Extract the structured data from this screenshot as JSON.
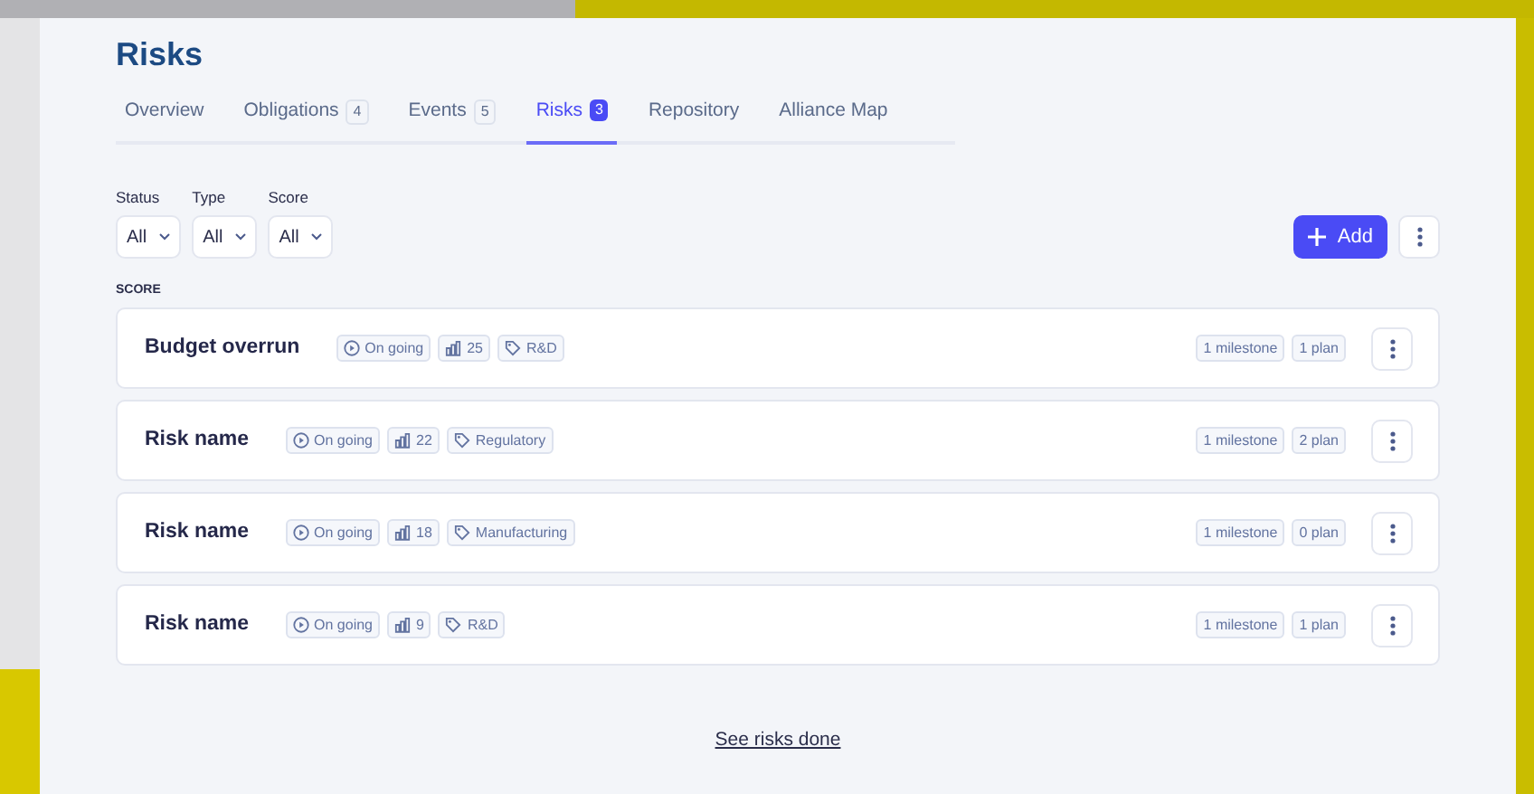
{
  "title": "Risks",
  "tabs": [
    {
      "label": "Overview",
      "selected": false
    },
    {
      "label": "Obligations",
      "count": "4",
      "selected": false
    },
    {
      "label": "Events",
      "count": "5",
      "selected": false
    },
    {
      "label": "Risks",
      "count": "3",
      "selected": true
    },
    {
      "label": "Repository",
      "selected": false
    },
    {
      "label": "Alliance Map",
      "selected": false
    }
  ],
  "filters": [
    {
      "label": "Status",
      "value": "All"
    },
    {
      "label": "Type",
      "value": "All"
    },
    {
      "label": "Score",
      "value": "All"
    }
  ],
  "add_button": "Add",
  "section_label": "SCORE",
  "risks": [
    {
      "name": "Budget overrun",
      "status": "On going",
      "score": "25",
      "tag": "R&D",
      "milestones": "1 milestone",
      "plans": "1 plan"
    },
    {
      "name": "Risk name",
      "status": "On going",
      "score": "22",
      "tag": "Regulatory",
      "milestones": "1 milestone",
      "plans": "2 plan"
    },
    {
      "name": "Risk name",
      "status": "On going",
      "score": "18",
      "tag": "Manufacturing",
      "milestones": "1 milestone",
      "plans": "0 plan"
    },
    {
      "name": "Risk name",
      "status": "On going",
      "score": "9",
      "tag": "R&D",
      "milestones": "1 milestone",
      "plans": "1 plan"
    }
  ],
  "footer_link": "See risks done"
}
